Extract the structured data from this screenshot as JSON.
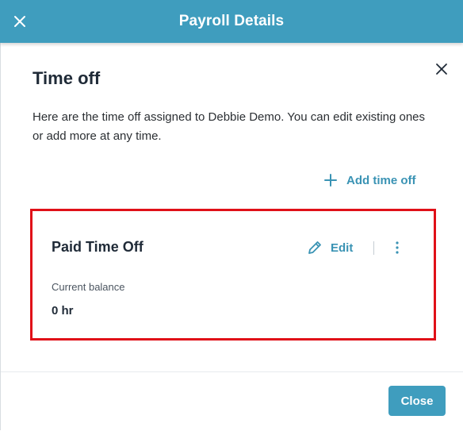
{
  "header": {
    "title": "Payroll Details",
    "close_icon": "close-icon"
  },
  "panel": {
    "close_icon": "close-icon",
    "title": "Time off",
    "description": "Here are the time off assigned to Debbie Demo. You can edit existing ones or add more at any time.",
    "add_button_label": "Add time off",
    "add_icon": "plus-icon"
  },
  "card": {
    "title": "Paid Time Off",
    "edit_label": "Edit",
    "edit_icon": "pencil-icon",
    "menu_icon": "kebab-menu-icon",
    "balance_label": "Current balance",
    "balance_value": "0 hr"
  },
  "footer": {
    "close_label": "Close"
  },
  "colors": {
    "brand": "#3f9dbe",
    "link": "#3a93b4",
    "highlight_border": "#e01018",
    "heading_text": "#1f2a37"
  }
}
